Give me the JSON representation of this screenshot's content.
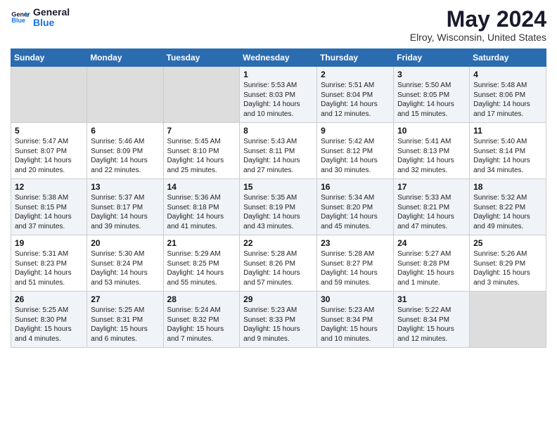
{
  "logo": {
    "line1": "General",
    "line2": "Blue"
  },
  "title": "May 2024",
  "subtitle": "Elroy, Wisconsin, United States",
  "days_of_week": [
    "Sunday",
    "Monday",
    "Tuesday",
    "Wednesday",
    "Thursday",
    "Friday",
    "Saturday"
  ],
  "weeks": [
    [
      {
        "day": "",
        "info": ""
      },
      {
        "day": "",
        "info": ""
      },
      {
        "day": "",
        "info": ""
      },
      {
        "day": "1",
        "info": "Sunrise: 5:53 AM\nSunset: 8:03 PM\nDaylight: 14 hours\nand 10 minutes."
      },
      {
        "day": "2",
        "info": "Sunrise: 5:51 AM\nSunset: 8:04 PM\nDaylight: 14 hours\nand 12 minutes."
      },
      {
        "day": "3",
        "info": "Sunrise: 5:50 AM\nSunset: 8:05 PM\nDaylight: 14 hours\nand 15 minutes."
      },
      {
        "day": "4",
        "info": "Sunrise: 5:48 AM\nSunset: 8:06 PM\nDaylight: 14 hours\nand 17 minutes."
      }
    ],
    [
      {
        "day": "5",
        "info": "Sunrise: 5:47 AM\nSunset: 8:07 PM\nDaylight: 14 hours\nand 20 minutes."
      },
      {
        "day": "6",
        "info": "Sunrise: 5:46 AM\nSunset: 8:09 PM\nDaylight: 14 hours\nand 22 minutes."
      },
      {
        "day": "7",
        "info": "Sunrise: 5:45 AM\nSunset: 8:10 PM\nDaylight: 14 hours\nand 25 minutes."
      },
      {
        "day": "8",
        "info": "Sunrise: 5:43 AM\nSunset: 8:11 PM\nDaylight: 14 hours\nand 27 minutes."
      },
      {
        "day": "9",
        "info": "Sunrise: 5:42 AM\nSunset: 8:12 PM\nDaylight: 14 hours\nand 30 minutes."
      },
      {
        "day": "10",
        "info": "Sunrise: 5:41 AM\nSunset: 8:13 PM\nDaylight: 14 hours\nand 32 minutes."
      },
      {
        "day": "11",
        "info": "Sunrise: 5:40 AM\nSunset: 8:14 PM\nDaylight: 14 hours\nand 34 minutes."
      }
    ],
    [
      {
        "day": "12",
        "info": "Sunrise: 5:38 AM\nSunset: 8:15 PM\nDaylight: 14 hours\nand 37 minutes."
      },
      {
        "day": "13",
        "info": "Sunrise: 5:37 AM\nSunset: 8:17 PM\nDaylight: 14 hours\nand 39 minutes."
      },
      {
        "day": "14",
        "info": "Sunrise: 5:36 AM\nSunset: 8:18 PM\nDaylight: 14 hours\nand 41 minutes."
      },
      {
        "day": "15",
        "info": "Sunrise: 5:35 AM\nSunset: 8:19 PM\nDaylight: 14 hours\nand 43 minutes."
      },
      {
        "day": "16",
        "info": "Sunrise: 5:34 AM\nSunset: 8:20 PM\nDaylight: 14 hours\nand 45 minutes."
      },
      {
        "day": "17",
        "info": "Sunrise: 5:33 AM\nSunset: 8:21 PM\nDaylight: 14 hours\nand 47 minutes."
      },
      {
        "day": "18",
        "info": "Sunrise: 5:32 AM\nSunset: 8:22 PM\nDaylight: 14 hours\nand 49 minutes."
      }
    ],
    [
      {
        "day": "19",
        "info": "Sunrise: 5:31 AM\nSunset: 8:23 PM\nDaylight: 14 hours\nand 51 minutes."
      },
      {
        "day": "20",
        "info": "Sunrise: 5:30 AM\nSunset: 8:24 PM\nDaylight: 14 hours\nand 53 minutes."
      },
      {
        "day": "21",
        "info": "Sunrise: 5:29 AM\nSunset: 8:25 PM\nDaylight: 14 hours\nand 55 minutes."
      },
      {
        "day": "22",
        "info": "Sunrise: 5:28 AM\nSunset: 8:26 PM\nDaylight: 14 hours\nand 57 minutes."
      },
      {
        "day": "23",
        "info": "Sunrise: 5:28 AM\nSunset: 8:27 PM\nDaylight: 14 hours\nand 59 minutes."
      },
      {
        "day": "24",
        "info": "Sunrise: 5:27 AM\nSunset: 8:28 PM\nDaylight: 15 hours\nand 1 minute."
      },
      {
        "day": "25",
        "info": "Sunrise: 5:26 AM\nSunset: 8:29 PM\nDaylight: 15 hours\nand 3 minutes."
      }
    ],
    [
      {
        "day": "26",
        "info": "Sunrise: 5:25 AM\nSunset: 8:30 PM\nDaylight: 15 hours\nand 4 minutes."
      },
      {
        "day": "27",
        "info": "Sunrise: 5:25 AM\nSunset: 8:31 PM\nDaylight: 15 hours\nand 6 minutes."
      },
      {
        "day": "28",
        "info": "Sunrise: 5:24 AM\nSunset: 8:32 PM\nDaylight: 15 hours\nand 7 minutes."
      },
      {
        "day": "29",
        "info": "Sunrise: 5:23 AM\nSunset: 8:33 PM\nDaylight: 15 hours\nand 9 minutes."
      },
      {
        "day": "30",
        "info": "Sunrise: 5:23 AM\nSunset: 8:34 PM\nDaylight: 15 hours\nand 10 minutes."
      },
      {
        "day": "31",
        "info": "Sunrise: 5:22 AM\nSunset: 8:34 PM\nDaylight: 15 hours\nand 12 minutes."
      },
      {
        "day": "",
        "info": ""
      }
    ]
  ]
}
